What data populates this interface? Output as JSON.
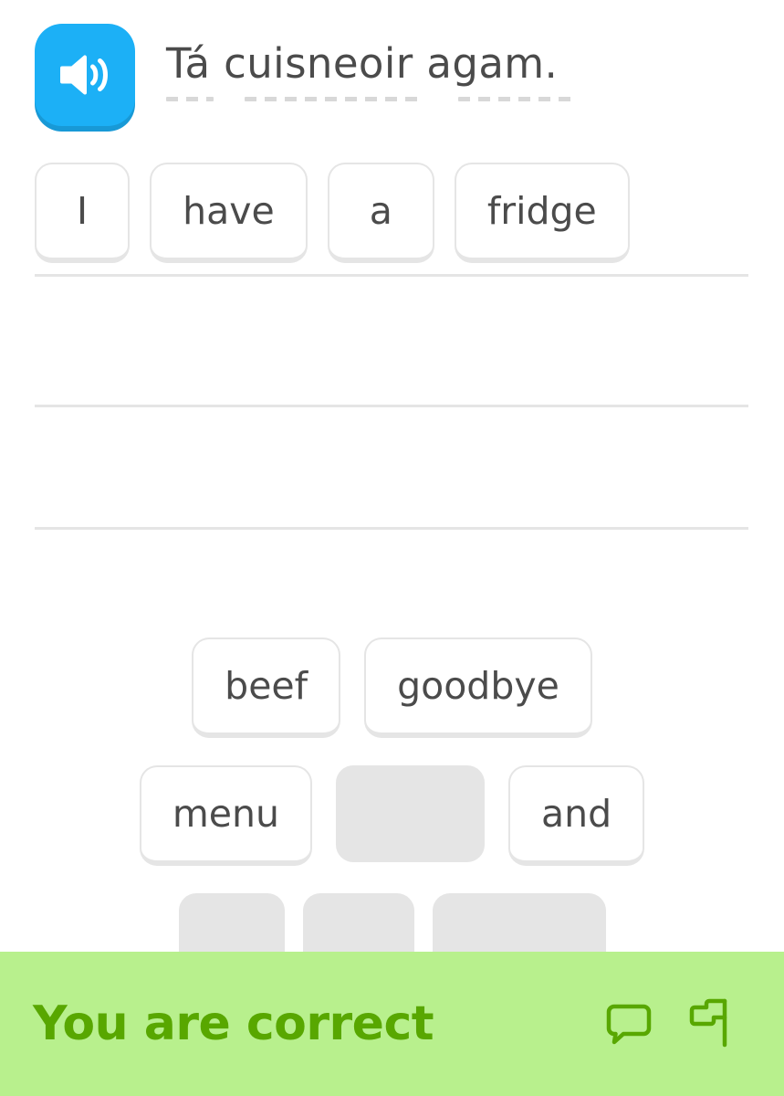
{
  "exercise": {
    "audio_button": {
      "icon": "speaker-icon",
      "color": "#1cb0f6",
      "shadow_color": "#1899d6"
    },
    "prompt": {
      "sentence": "Tá cuisneoir agam.",
      "words": [
        "Tá",
        "cuisneoir",
        "agam."
      ],
      "text_color": "#4b4b4b",
      "underline_color": "#d8d8d8"
    },
    "answer_tiles": [
      {
        "label": "I"
      },
      {
        "label": "have"
      },
      {
        "label": "a"
      },
      {
        "label": "fridge"
      }
    ],
    "answer_lines": 3,
    "word_bank": {
      "rows": [
        {
          "items": [
            {
              "type": "word",
              "label": "beef"
            },
            {
              "type": "word",
              "label": "goodbye"
            }
          ]
        },
        {
          "items": [
            {
              "type": "word",
              "label": "menu"
            },
            {
              "type": "used",
              "label": ""
            },
            {
              "type": "word",
              "label": "and"
            }
          ]
        },
        {
          "items": [
            {
              "type": "used",
              "label": ""
            },
            {
              "type": "used",
              "label": ""
            },
            {
              "type": "used",
              "label": ""
            }
          ]
        }
      ]
    }
  },
  "feedback_banner": {
    "title": "You are correct",
    "background_color": "#b8f08d",
    "text_color": "#58a700",
    "actions": [
      {
        "icon": "speech-bubble-icon",
        "name": "discuss-button"
      },
      {
        "icon": "flag-icon",
        "name": "report-button"
      }
    ]
  }
}
